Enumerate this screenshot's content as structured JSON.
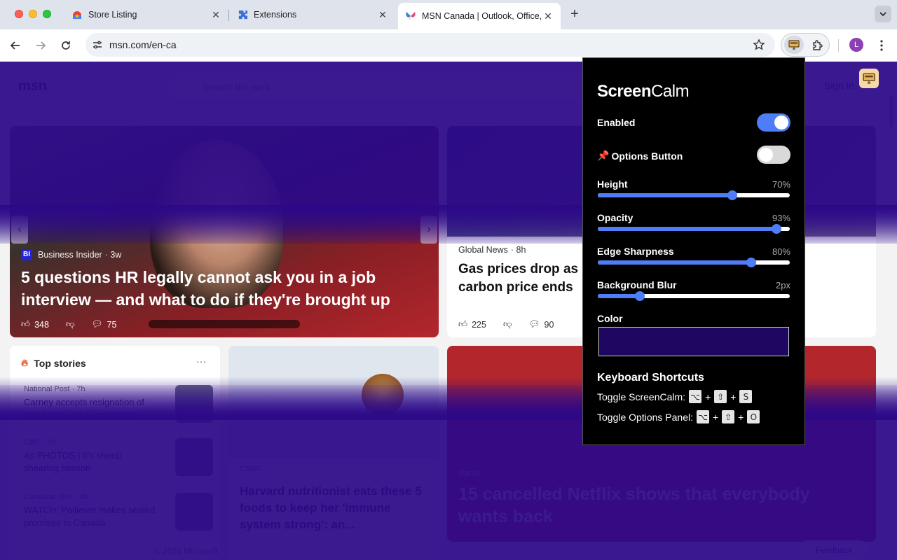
{
  "browser": {
    "tabs": [
      {
        "title": "Store Listing",
        "icon": "chrome-web-store-icon",
        "active": false
      },
      {
        "title": "Extensions",
        "icon": "puzzle-icon",
        "active": false
      },
      {
        "title": "MSN Canada | Outlook, Office, Skype",
        "icon": "msn-butterfly-icon",
        "active": true
      }
    ],
    "url": "msn.com/en-ca",
    "profile_initial": "L"
  },
  "page": {
    "logo": "msn",
    "search_placeholder": "Search the web",
    "sign_in": "Sign in",
    "hero": {
      "source": "Business Insider",
      "source_badge": "BI",
      "age": "· 3w",
      "headline": "5 questions HR legally cannot ask you in a job interview — and what to do if they're brought up",
      "likes": "348",
      "comments": "75"
    },
    "card2": {
      "source": "Global News",
      "age": "· 8h",
      "headline": "Gas prices drop as carbon price ends",
      "likes": "225",
      "comments": "90"
    },
    "top_stories": {
      "title": "Top stories",
      "more": "···",
      "items": [
        {
          "source": "National Post · 7h",
          "title": "Carney accepts resignation of candidate who suggested re..."
        },
        {
          "source": "CBC · 7h",
          "title": "As PHOTOS | It's sheep shearing season"
        },
        {
          "source": "Canadian Sun · 4h",
          "title": "WATCH: Poilievre makes sealed promises to Canada"
        }
      ]
    },
    "food_card": {
      "source": "CNBC",
      "headline": "Harvard nutritionist eats these 5 foods to keep her 'immune system strong': an..."
    },
    "netflix_card": {
      "source": "Mania",
      "headline": "15 cancelled Netflix shows that everybody wants back"
    },
    "footer": "© 2025 Microsoft",
    "feedback": "Feedback"
  },
  "popup": {
    "brand_bold": "Screen",
    "brand_light": "Calm",
    "enabled_label": "Enabled",
    "enabled": true,
    "options_button_label": "Options Button",
    "options_button_icon": "pushpin-icon",
    "options_button_enabled": false,
    "sliders": [
      {
        "key": "height",
        "label": "Height",
        "display": "70%",
        "fraction": 0.7
      },
      {
        "key": "opacity",
        "label": "Opacity",
        "display": "93%",
        "fraction": 0.93
      },
      {
        "key": "edge",
        "label": "Edge Sharpness",
        "display": "80%",
        "fraction": 0.8
      },
      {
        "key": "blur",
        "label": "Background Blur",
        "display": "2px",
        "fraction": 0.22
      }
    ],
    "color_label": "Color",
    "color_value": "#1e0760",
    "shortcuts_title": "Keyboard Shortcuts",
    "shortcuts": [
      {
        "label": "Toggle ScreenCalm:",
        "keys": [
          "⌥",
          "⇧",
          "S"
        ]
      },
      {
        "label": "Toggle Options Panel:",
        "keys": [
          "⌥",
          "⇧",
          "O"
        ]
      }
    ]
  },
  "colors": {
    "accent": "#4f7df7",
    "overlay": "#2c0888"
  }
}
